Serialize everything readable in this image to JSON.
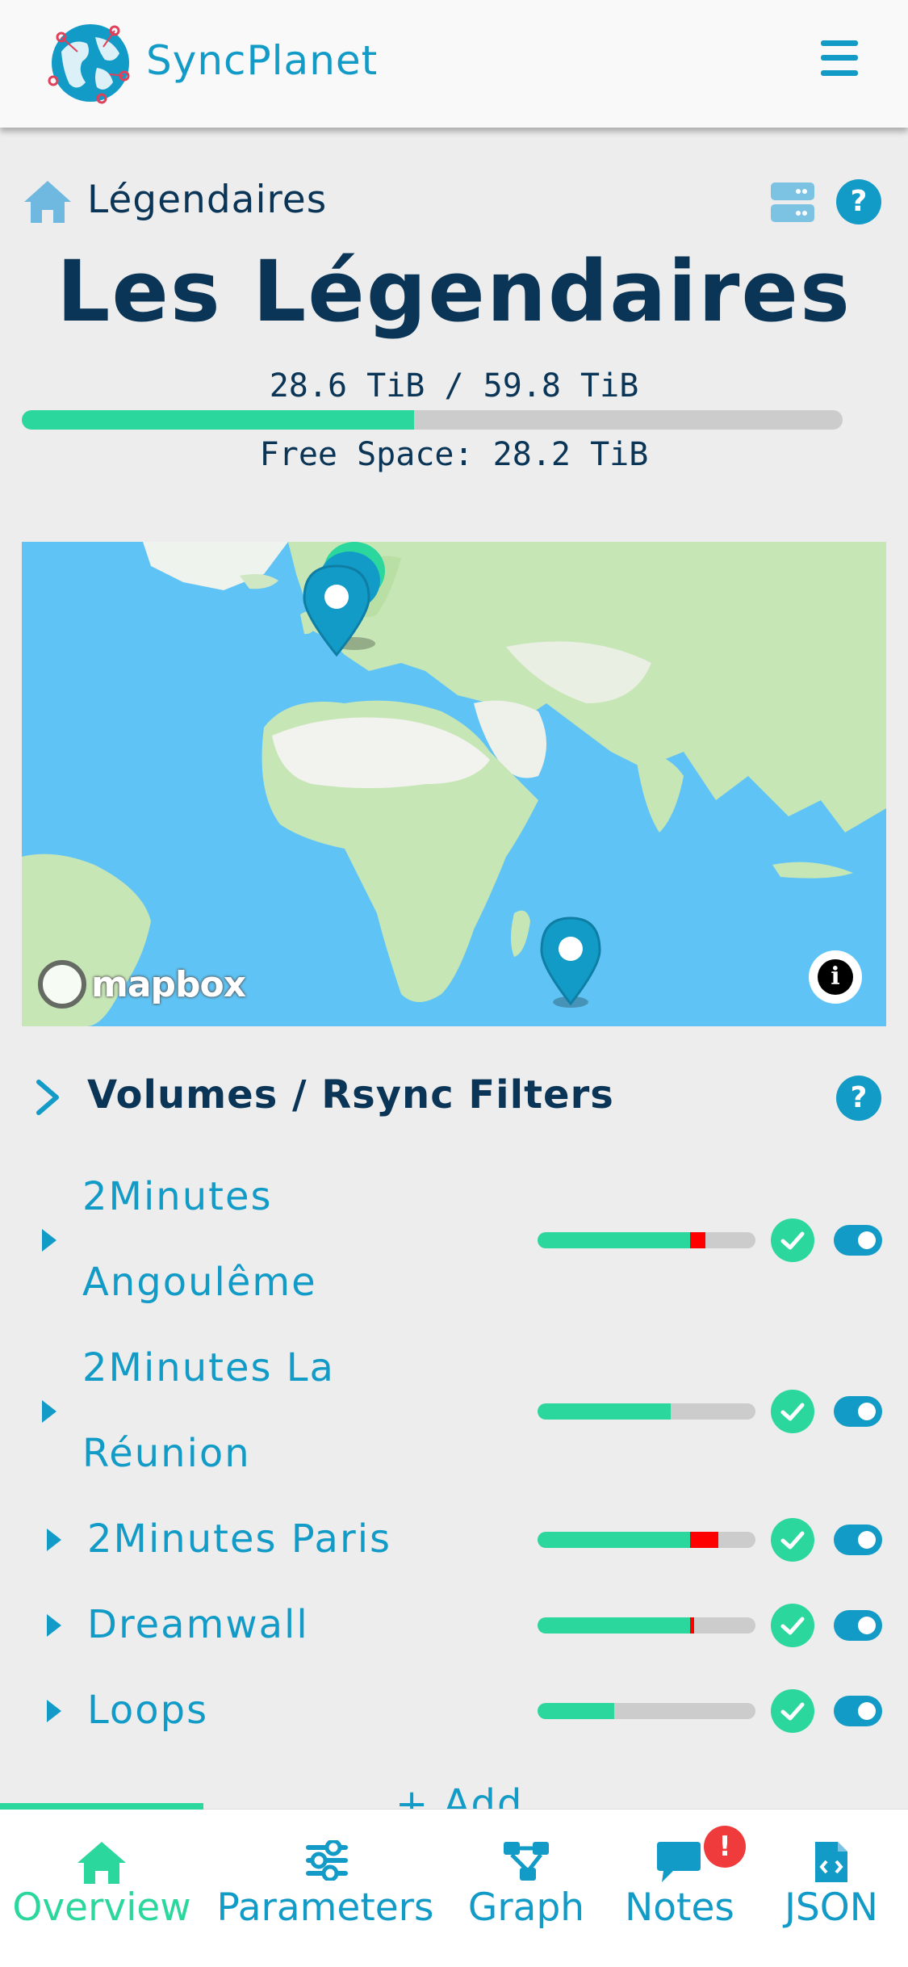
{
  "header": {
    "brand": "SyncPlanet",
    "logo_icon": "globe-network-icon",
    "menu_icon": "hamburger-icon"
  },
  "breadcrumb": {
    "home_icon": "home-icon",
    "label": "Légendaires"
  },
  "page": {
    "title": "Les Légendaires",
    "storage_text": "28.6 TiB / 59.8 TiB",
    "storage_used_fraction": 0.478,
    "free_space_text": "Free Space: 28.2 TiB"
  },
  "map": {
    "attribution": "mapbox",
    "info_label": "i",
    "markers": [
      "europe-cluster",
      "reunion"
    ]
  },
  "volumes_section": {
    "title": "Volumes / Rsync Filters",
    "help_label": "?",
    "items": [
      {
        "line1": "2Minutes",
        "line2": "Angoulême",
        "green": 0.7,
        "red": 0.07,
        "status": "ok",
        "enabled": true
      },
      {
        "line1": "2Minutes La",
        "line2": "Réunion",
        "green": 0.61,
        "red": 0.0,
        "status": "ok",
        "enabled": true
      },
      {
        "line1": "2Minutes Paris",
        "green": 0.7,
        "red": 0.13,
        "status": "ok",
        "enabled": true
      },
      {
        "line1": "Dreamwall",
        "green": 0.7,
        "red": 0.02,
        "status": "ok",
        "enabled": true
      },
      {
        "line1": "Loops",
        "green": 0.35,
        "red": 0.0,
        "status": "ok",
        "enabled": true
      }
    ],
    "add_label": "+ Add"
  },
  "header_help_label": "?",
  "bottom_nav": {
    "items": [
      {
        "label": "Overview",
        "icon": "home-icon",
        "active": true
      },
      {
        "label": "Parameters",
        "icon": "sliders-icon",
        "active": false
      },
      {
        "label": "Graph",
        "icon": "graph-icon",
        "active": false
      },
      {
        "label": "Notes",
        "icon": "comment-icon",
        "active": false,
        "badge": "!"
      },
      {
        "label": "JSON",
        "icon": "json-file-icon",
        "active": false
      }
    ]
  },
  "colors": {
    "accent": "#139bc8",
    "dark": "#0b3556",
    "green": "#2bd79c",
    "red": "#ff0000",
    "badge": "#ef3b3b"
  }
}
